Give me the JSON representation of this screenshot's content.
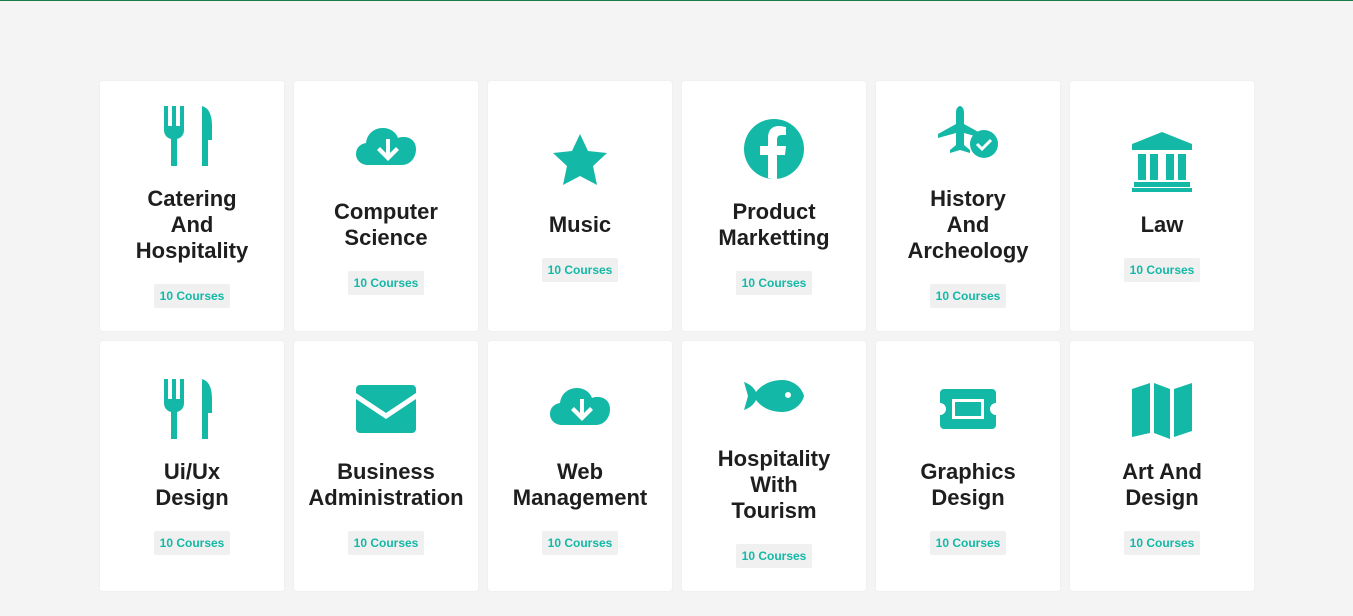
{
  "colors": {
    "accent": "#14b8a6",
    "top_border": "#1a7a4a",
    "background": "#f4f4f4"
  },
  "categories": [
    {
      "title": "Catering\nAnd\nHospitality",
      "count": "10 Courses",
      "icon": "utensils-icon"
    },
    {
      "title": "Computer\nScience",
      "count": "10 Courses",
      "icon": "cloud-download-icon"
    },
    {
      "title": "Music",
      "count": "10 Courses",
      "icon": "star-icon"
    },
    {
      "title": "Product\nMarketting",
      "count": "10 Courses",
      "icon": "facebook-icon"
    },
    {
      "title": "History\nAnd\nArcheology",
      "count": "10 Courses",
      "icon": "plane-check-icon"
    },
    {
      "title": "Law",
      "count": "10 Courses",
      "icon": "landmark-icon"
    },
    {
      "title": "Ui/Ux\nDesign",
      "count": "10 Courses",
      "icon": "utensils-icon"
    },
    {
      "title": "Business\nAdministration",
      "count": "10 Courses",
      "icon": "envelope-icon"
    },
    {
      "title": "Web\nManagement",
      "count": "10 Courses",
      "icon": "cloud-download-icon"
    },
    {
      "title": "Hospitality\nWith\nTourism",
      "count": "10 Courses",
      "icon": "fish-icon"
    },
    {
      "title": "Graphics\nDesign",
      "count": "10 Courses",
      "icon": "ticket-icon"
    },
    {
      "title": "Art And\nDesign",
      "count": "10 Courses",
      "icon": "map-icon"
    }
  ]
}
